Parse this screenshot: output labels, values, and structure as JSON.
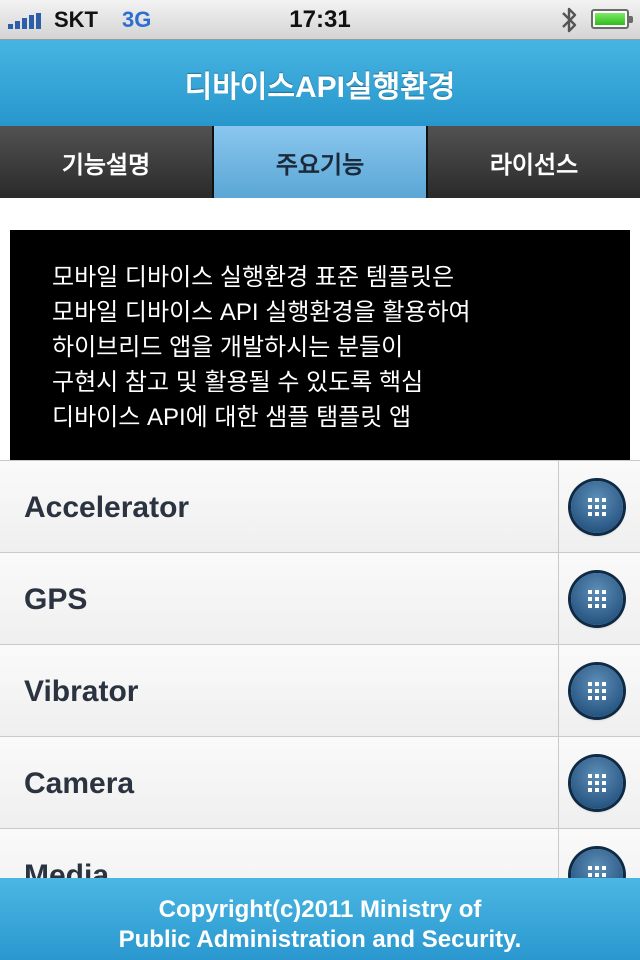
{
  "status_bar": {
    "carrier": "SKT",
    "network": "3G",
    "time": "17:31",
    "bluetooth_icon": "bluetooth-icon",
    "battery_icon": "battery-icon",
    "signal_icon": "signal-bars-icon",
    "battery_level": 1.0
  },
  "header": {
    "title": "디바이스API실행환경"
  },
  "tabs": [
    {
      "label": "기능설명",
      "active": false
    },
    {
      "label": "주요기능",
      "active": true
    },
    {
      "label": "라이선스",
      "active": false
    }
  ],
  "intro": {
    "lines": [
      "모바일 디바이스 실행환경 표준 템플릿은",
      "모바일 디바이스 API 실행환경을 활용하여",
      "하이브리드 앱을 개발하시는 분들이",
      "구현시 참고 및 활용될 수 있도록 핵심",
      "디바이스 API에 대한 샘플 탬플릿 앱"
    ]
  },
  "list": {
    "items": [
      {
        "label": "Accelerator"
      },
      {
        "label": "GPS"
      },
      {
        "label": "Vibrator"
      },
      {
        "label": "Camera"
      },
      {
        "label": "Media"
      }
    ],
    "button_icon": "grid-icon"
  },
  "footer": {
    "line1": "Copyright(c)2011 Ministry of",
    "line2": "Public Administration and Security."
  },
  "colors": {
    "header": "#2f9fd4",
    "active_tab": "#7bbce6",
    "tab": "#3a3a3a",
    "list_button": "#2b5a86"
  }
}
